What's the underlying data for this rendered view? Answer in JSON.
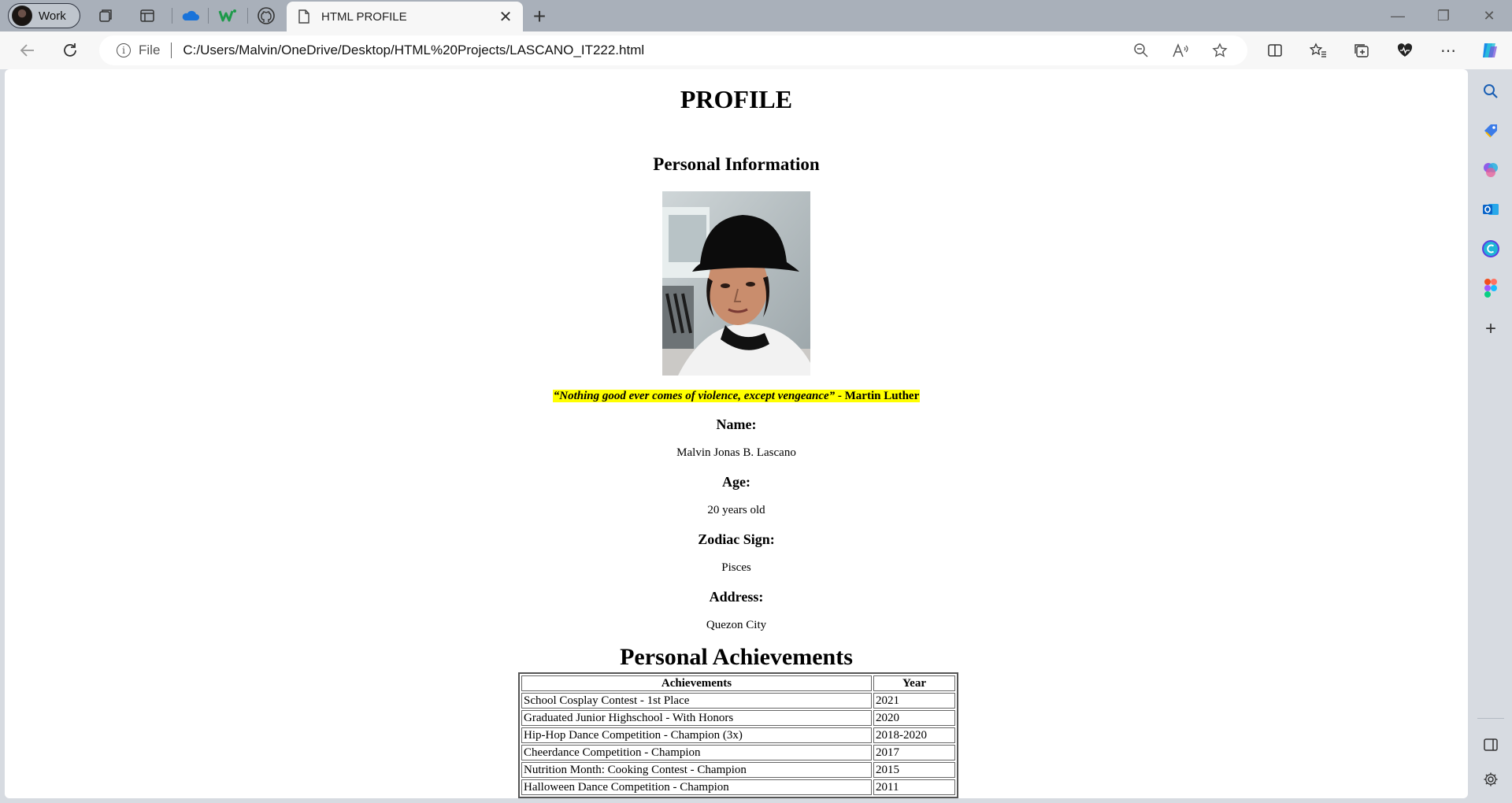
{
  "browser": {
    "profile_label": "Work",
    "active_tab_title": "HTML PROFILE",
    "address": {
      "scheme_label": "File",
      "url": "C:/Users/Malvin/OneDrive/Desktop/HTML%20Projects/LASCANO_IT222.html"
    }
  },
  "page": {
    "title": "PROFILE",
    "section_personal": "Personal Information",
    "quote_text": "“Nothing good ever comes of violence, except vengeance”",
    "quote_author": " - Martin Luther",
    "fields": [
      {
        "label": "Name:",
        "value": "Malvin Jonas B. Lascano"
      },
      {
        "label": "Age:",
        "value": "20 years old"
      },
      {
        "label": "Zodiac Sign:",
        "value": "Pisces"
      },
      {
        "label": "Address:",
        "value": "Quezon City"
      }
    ],
    "section_achievements": "Personal Achievements",
    "table": {
      "headers": [
        "Achievements",
        "Year"
      ],
      "rows": [
        [
          "School Cosplay Contest - 1st Place",
          "2021"
        ],
        [
          "Graduated Junior Highschool - With Honors",
          "2020"
        ],
        [
          "Hip-Hop Dance Competition - Champion (3x)",
          "2018-2020"
        ],
        [
          "Cheerdance Competition - Champion",
          "2017"
        ],
        [
          "Nutrition Month: Cooking Contest - Champion",
          "2015"
        ],
        [
          "Halloween Dance Competition - Champion",
          "2011"
        ]
      ]
    }
  },
  "colors": {
    "highlight": "#ffff00",
    "tabstrip": "#a9b0ba",
    "toolbar": "#f7f7f7"
  }
}
